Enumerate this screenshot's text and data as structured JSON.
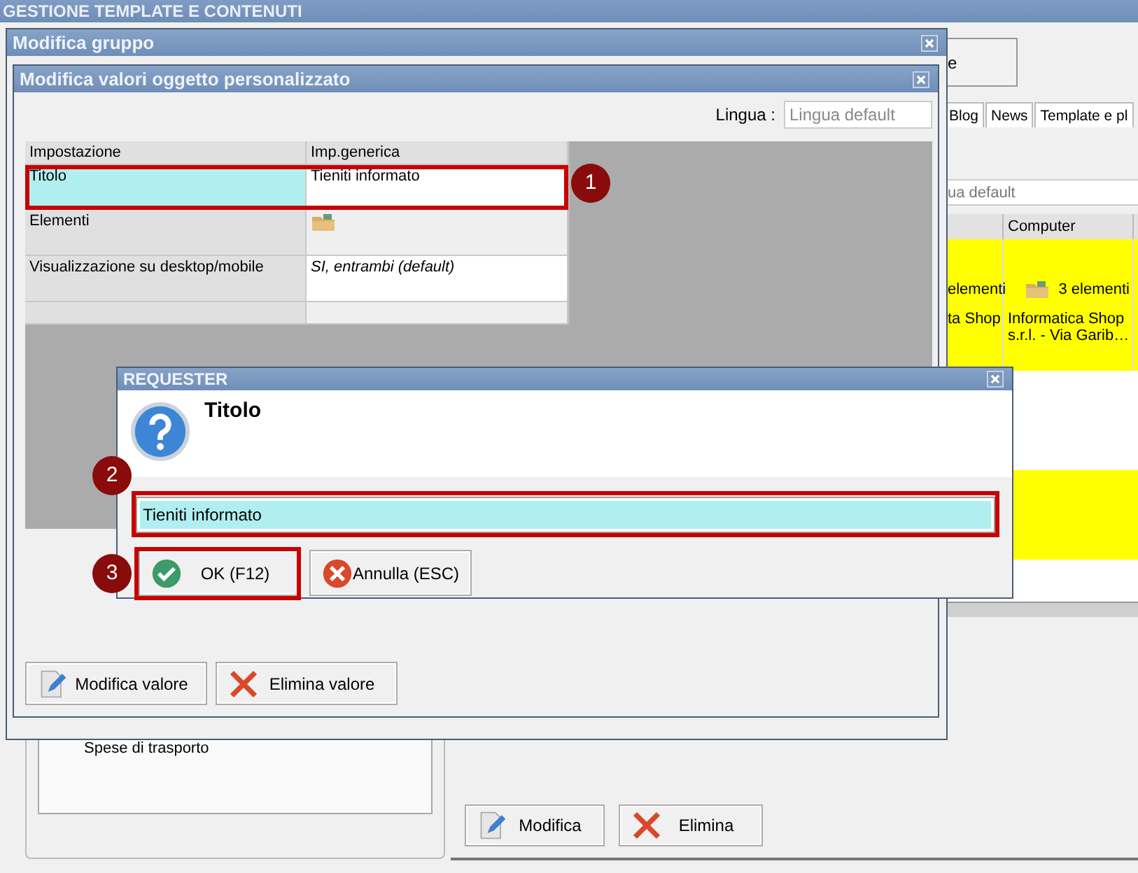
{
  "app": {
    "title": "GESTIONE TEMPLATE E CONTENUTI",
    "top_button": "e",
    "tabs": [
      {
        "label": "Blog",
        "selected": false
      },
      {
        "label": "News",
        "selected": false
      },
      {
        "label": "Template e pl",
        "selected": false
      }
    ],
    "language_field": {
      "placeholder": "ua default"
    },
    "table": {
      "columns": [
        "Computer"
      ],
      "rows": [
        {
          "highlighted": true,
          "cells": [
            {
              "kind": "count",
              "text": "elementi"
            },
            {
              "kind": "count",
              "text": "3 elementi"
            }
          ]
        },
        {
          "highlighted": true,
          "cells": [
            {
              "kind": "text",
              "text": "ta Shop"
            },
            {
              "kind": "text",
              "text": "Informatica Shop s.r.l. - Via Garib…"
            }
          ]
        },
        {
          "highlighted": false
        },
        {
          "highlighted": true
        },
        {
          "highlighted": false
        }
      ]
    },
    "tree": {
      "items": [
        "Spese di trasporto"
      ]
    },
    "buttons": [
      {
        "label": "Modifica",
        "kind": "edit"
      },
      {
        "label": "Elimina",
        "kind": "delete"
      }
    ]
  },
  "group_window": {
    "title": "Modifica gruppo"
  },
  "values_window": {
    "title": "Modifica valori oggetto personalizzato",
    "language_label": "Lingua :",
    "language_field": {
      "placeholder": "Lingua default"
    },
    "table": {
      "columns": [
        "Impostazione",
        "Imp.generica"
      ],
      "rows": [
        {
          "setting": "Titolo",
          "kind": "text",
          "value": "Tieniti informato",
          "selected": true
        },
        {
          "setting": "Elementi",
          "kind": "folder",
          "selected": false
        },
        {
          "setting": "Visualizzazione su desktop/mobile",
          "kind": "default",
          "value": "SI, entrambi (default)",
          "selected": false
        }
      ]
    },
    "buttons": [
      {
        "label": "Modifica valore",
        "kind": "edit"
      },
      {
        "label": "Elimina valore",
        "kind": "delete"
      }
    ]
  },
  "requester": {
    "title": "REQUESTER",
    "heading": "Titolo",
    "input": {
      "value": "Tieniti informato"
    },
    "buttons": [
      {
        "label": "OK (F12)",
        "kind": "ok"
      },
      {
        "label": "Annulla (ESC)",
        "kind": "cancel"
      }
    ]
  },
  "callouts": [
    {
      "label": "1"
    },
    {
      "label": "2"
    },
    {
      "label": "3"
    }
  ]
}
